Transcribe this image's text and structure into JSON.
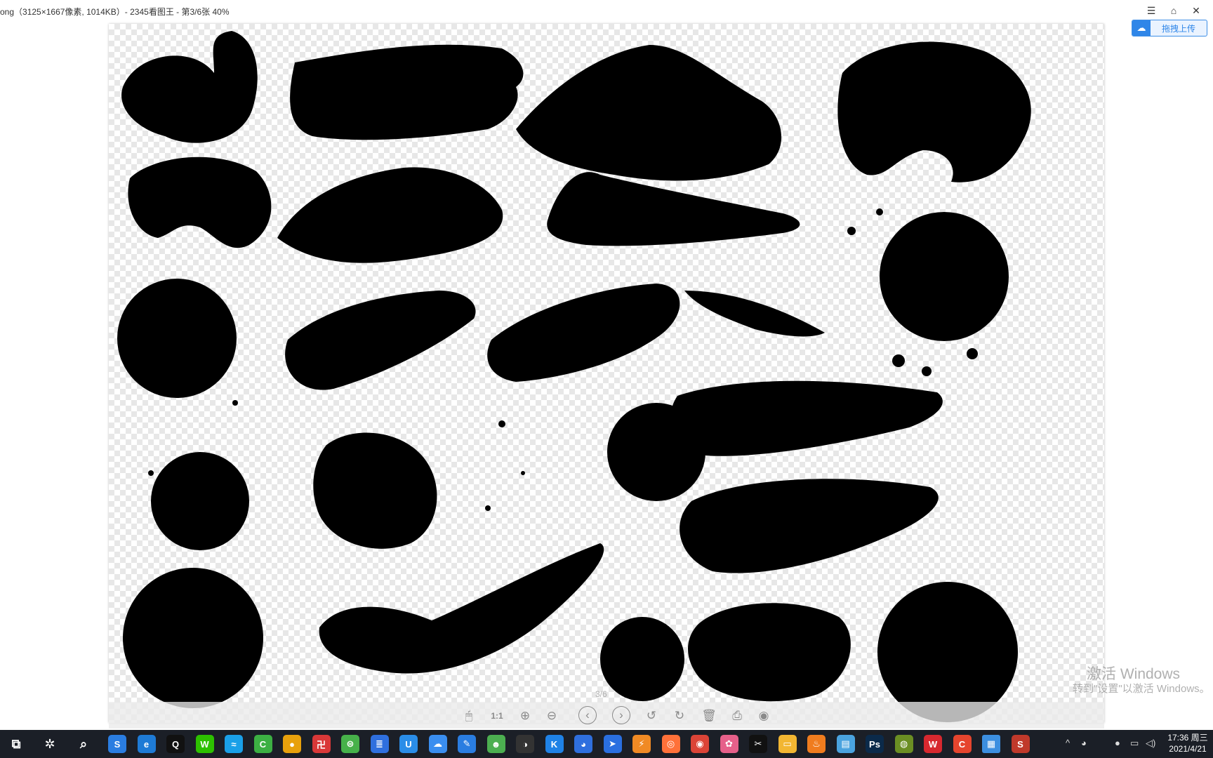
{
  "window": {
    "title": "ong（3125×1667像素, 1014KB）- 2345看图王 - 第3/6张 40%",
    "controls": {
      "menu": "☰",
      "skin": "⌂",
      "close": "✕"
    },
    "upload": {
      "icon": "cloud-icon",
      "label": "拖拽上传",
      "accent": "#2f86e8"
    }
  },
  "viewer": {
    "page_counter": "3/6",
    "toolbar": [
      {
        "name": "mouse-icon",
        "glyph": "🖱"
      },
      {
        "name": "actual-size-button",
        "glyph": "1:1"
      },
      {
        "name": "zoom-in-icon",
        "glyph": "⊕"
      },
      {
        "name": "zoom-out-icon",
        "glyph": "⊖"
      },
      {
        "name": "previous-icon",
        "glyph": "‹"
      },
      {
        "name": "next-icon",
        "glyph": "›"
      },
      {
        "name": "rotate-left-icon",
        "glyph": "↺"
      },
      {
        "name": "rotate-right-icon",
        "glyph": "↻"
      },
      {
        "name": "delete-icon",
        "glyph": "🗑"
      },
      {
        "name": "print-icon",
        "glyph": "⎙"
      },
      {
        "name": "more-icon",
        "glyph": "◉"
      }
    ]
  },
  "watermark": {
    "line1": "激活 Windows",
    "line2": "转到\"设置\"以激活 Windows。"
  },
  "taskbar": {
    "apps": [
      {
        "name": "task-view-icon",
        "glyph": "⧉",
        "color": "transparent"
      },
      {
        "name": "pinwheel-icon",
        "glyph": "✲",
        "color": "transparent"
      },
      {
        "name": "search-icon",
        "glyph": "⌕",
        "color": "transparent"
      },
      {
        "name": "sogou-browser-icon",
        "glyph": "S",
        "color": "#2a7de1"
      },
      {
        "name": "edge-icon",
        "glyph": "e",
        "color": "#1e7bd6"
      },
      {
        "name": "qq-icon",
        "glyph": "Q",
        "color": "#111111"
      },
      {
        "name": "wechat-icon",
        "glyph": "W",
        "color": "#2dc100"
      },
      {
        "name": "screen-capture-icon",
        "glyph": "≈",
        "color": "#1aa0e8"
      },
      {
        "name": "camtasia-icon",
        "glyph": "C",
        "color": "#3cb043"
      },
      {
        "name": "chrome-icon",
        "glyph": "●",
        "color": "#e8a10c"
      },
      {
        "name": "app-red-icon",
        "glyph": "卍",
        "color": "#d93838"
      },
      {
        "name": "app-green-icon",
        "glyph": "⊜",
        "color": "#47b14a"
      },
      {
        "name": "app-blue-doc-icon",
        "glyph": "≣",
        "color": "#2f6fde"
      },
      {
        "name": "app-cup-icon",
        "glyph": "U",
        "color": "#2a8de8"
      },
      {
        "name": "baidu-netdisk-icon",
        "glyph": "☁",
        "color": "#3a8ef0"
      },
      {
        "name": "app-pen-icon",
        "glyph": "✎",
        "color": "#2a7de1"
      },
      {
        "name": "app-frog-icon",
        "glyph": "☻",
        "color": "#4caf50"
      },
      {
        "name": "app-panda-icon",
        "glyph": "◑",
        "color": "#333333"
      },
      {
        "name": "kugou-icon",
        "glyph": "K",
        "color": "#1f82e6"
      },
      {
        "name": "app-ball-icon",
        "glyph": "◕",
        "color": "#2f6fde"
      },
      {
        "name": "feishu-icon",
        "glyph": "➤",
        "color": "#2a6fe0"
      },
      {
        "name": "app-orange-icon",
        "glyph": "⚡",
        "color": "#f08a24"
      },
      {
        "name": "firefox-icon",
        "glyph": "◎",
        "color": "#ff7139"
      },
      {
        "name": "chrome-2-icon",
        "glyph": "◉",
        "color": "#db4437"
      },
      {
        "name": "app-pink-icon",
        "glyph": "✿",
        "color": "#e6608a"
      },
      {
        "name": "capcut-icon",
        "glyph": "✂",
        "color": "#111111"
      },
      {
        "name": "folder-icon",
        "glyph": "▭",
        "color": "#f2b632"
      },
      {
        "name": "app-flame-icon",
        "glyph": "♨",
        "color": "#f07c1e"
      },
      {
        "name": "app-book-icon",
        "glyph": "▤",
        "color": "#4aa3df"
      },
      {
        "name": "photoshop-icon",
        "glyph": "Ps",
        "color": "#0b2a4a"
      },
      {
        "name": "app-globe-icon",
        "glyph": "◍",
        "color": "#6b8e23"
      },
      {
        "name": "wps-icon",
        "glyph": "W",
        "color": "#d7282f"
      },
      {
        "name": "app-c-icon",
        "glyph": "C",
        "color": "#e6452e"
      },
      {
        "name": "image-viewer-icon",
        "glyph": "▦",
        "color": "#3c8fe0"
      },
      {
        "name": "app-s-icon",
        "glyph": "S",
        "color": "#c0392b"
      }
    ],
    "tray": {
      "chevron": "^",
      "clock_time": "17:36 周三",
      "clock_date": "2021/4/21"
    }
  }
}
